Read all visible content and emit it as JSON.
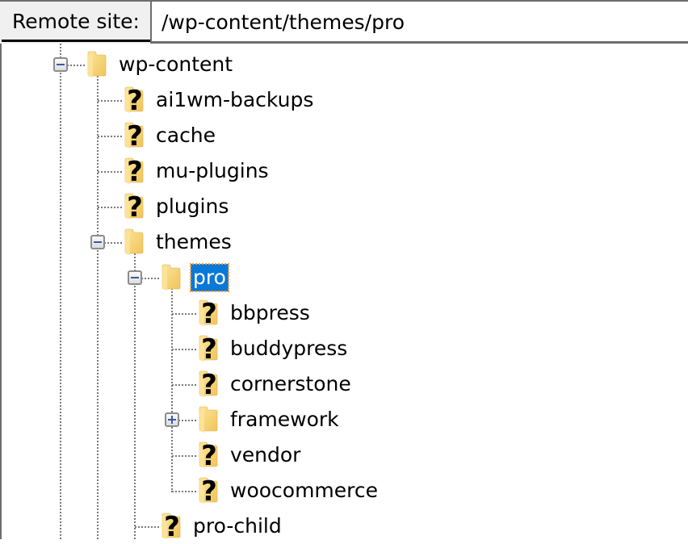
{
  "header": {
    "label": "Remote site:",
    "path_value": "/wp-content/themes/pro"
  },
  "tree": {
    "nodes": [
      {
        "label": "wp-content",
        "icon": "folder-icon",
        "toggle": "collapse",
        "depth": 0
      },
      {
        "label": "ai1wm-backups",
        "icon": "folder-unknown-icon",
        "toggle": null,
        "depth": 1
      },
      {
        "label": "cache",
        "icon": "folder-unknown-icon",
        "toggle": null,
        "depth": 1
      },
      {
        "label": "mu-plugins",
        "icon": "folder-unknown-icon",
        "toggle": null,
        "depth": 1
      },
      {
        "label": "plugins",
        "icon": "folder-unknown-icon",
        "toggle": null,
        "depth": 1
      },
      {
        "label": "themes",
        "icon": "folder-icon",
        "toggle": "collapse",
        "depth": 1
      },
      {
        "label": "pro",
        "icon": "folder-icon",
        "toggle": "collapse",
        "depth": 2,
        "selected": true
      },
      {
        "label": "bbpress",
        "icon": "folder-unknown-icon",
        "toggle": null,
        "depth": 3
      },
      {
        "label": "buddypress",
        "icon": "folder-unknown-icon",
        "toggle": null,
        "depth": 3
      },
      {
        "label": "cornerstone",
        "icon": "folder-unknown-icon",
        "toggle": null,
        "depth": 3
      },
      {
        "label": "framework",
        "icon": "folder-icon",
        "toggle": "expand",
        "depth": 3
      },
      {
        "label": "vendor",
        "icon": "folder-unknown-icon",
        "toggle": null,
        "depth": 3
      },
      {
        "label": "woocommerce",
        "icon": "folder-unknown-icon",
        "toggle": null,
        "depth": 3
      },
      {
        "label": "pro-child",
        "icon": "folder-unknown-icon",
        "toggle": null,
        "depth": 2
      }
    ]
  },
  "colors": {
    "selection": "#0a78d7",
    "focus_outline": "#f39c3c",
    "toggle_glyph": "#3c58a8",
    "folder": "#f5cd6a"
  }
}
